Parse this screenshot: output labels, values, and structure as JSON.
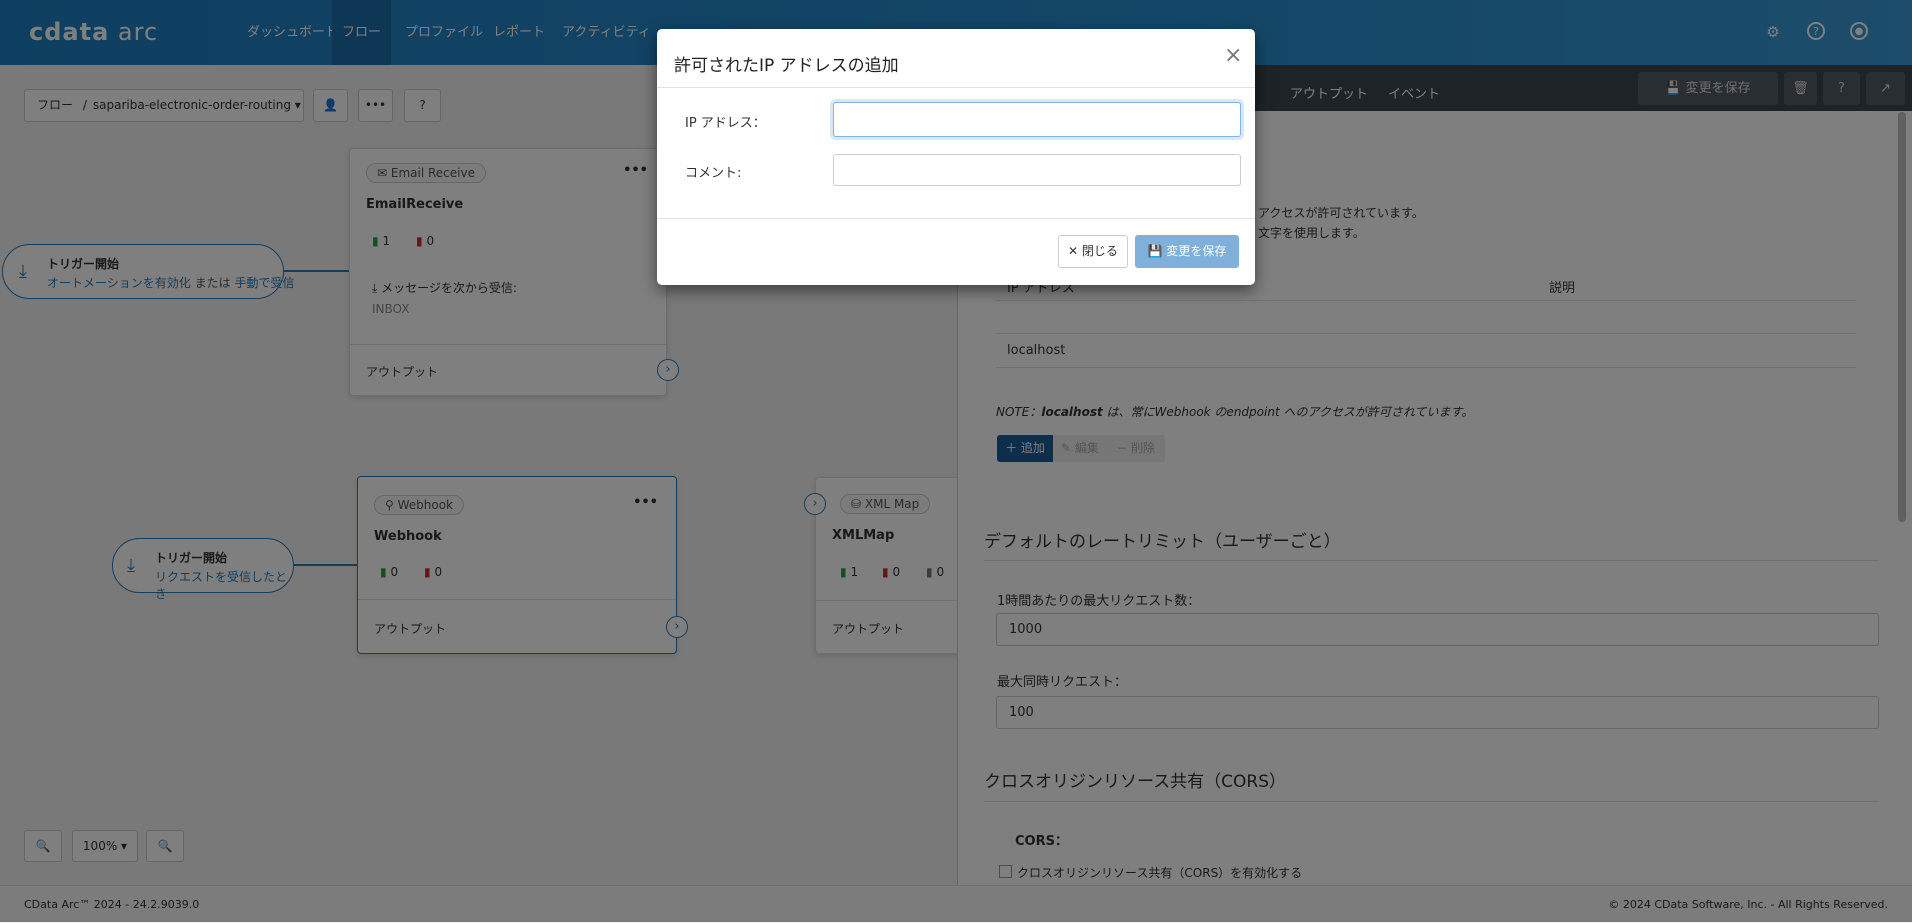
{
  "header": {
    "logo": "cdata arc",
    "nav": [
      "ダッシュボード",
      "フロー",
      "プロファイル",
      "レポート",
      "アクティビティ"
    ],
    "active_nav": "フロー",
    "icons": [
      "gear-icon",
      "help-icon",
      "user-icon"
    ]
  },
  "breadcrumb": {
    "root": "フロー",
    "separator": "/",
    "flow": "sapariba-electronic-order-routing"
  },
  "canvas": {
    "email_card": {
      "type": "Email Receive",
      "name": "EmailReceive",
      "success": "1",
      "error": "0",
      "receive_label": "メッセージを次から受信:",
      "folder": "INBOX",
      "output": "アウトプット"
    },
    "trigger1": {
      "title": "トリガー開始",
      "desc_a": "オートメーションを有効化",
      "desc_or": "または",
      "desc_b": "手動で受信"
    },
    "webhook_card": {
      "type": "Webhook",
      "name": "Webhook",
      "success": "0",
      "error": "0",
      "output": "アウトプット"
    },
    "trigger2": {
      "title": "トリガー開始",
      "desc": "リクエストを受信したとき"
    },
    "xml_card": {
      "type": "XML Map",
      "name": "XMLMap",
      "success": "1",
      "error": "0",
      "other": "0",
      "output": "アウトプット"
    },
    "zoom": "100%"
  },
  "panel": {
    "tabs": [
      "アウトプット",
      "イベント"
    ],
    "save": "変更を保存",
    "text1": "アクセスが許可されています。",
    "text2": "文字を使用します。",
    "table_headers": [
      "IP アドレス",
      "説明"
    ],
    "rows": [
      [
        "",
        ""
      ],
      [
        "localhost",
        ""
      ]
    ],
    "note_prefix": "NOTE：",
    "note_bold": "localhost",
    "note_rest": " は、常にWebhook のendpoint へのアクセスが許可されています。",
    "add": "追加",
    "edit": "編集",
    "delete": "削除",
    "rate_heading": "デフォルトのレートリミット（ユーザーごと）",
    "max_req_label": "1時間あたりの最大リクエスト数：",
    "max_req": "1000",
    "concurrent_label": "最大同時リクエスト：",
    "concurrent": "100",
    "cors_heading": "クロスオリジンリソース共有（CORS）",
    "cors_label": "CORS：",
    "cors_checkbox": "クロスオリジンリソース共有（CORS）を有効化する",
    "cors_checked": false
  },
  "modal": {
    "title": "許可されたIP アドレスの追加",
    "ip_label": "IP アドレス：",
    "ip_value": "",
    "comment_label": "コメント:",
    "comment_value": "",
    "close": "閉じる",
    "save": "変更を保存"
  },
  "footer": {
    "left": "CData Arc™ 2024 - 24.2.9039.0",
    "right": "© 2024 CData Software, Inc. - All Rights Reserved."
  },
  "colors": {
    "header": "#1f7fc1",
    "primary": "#1a5f96",
    "success": "#2e9b3e",
    "error": "#c9302c"
  }
}
